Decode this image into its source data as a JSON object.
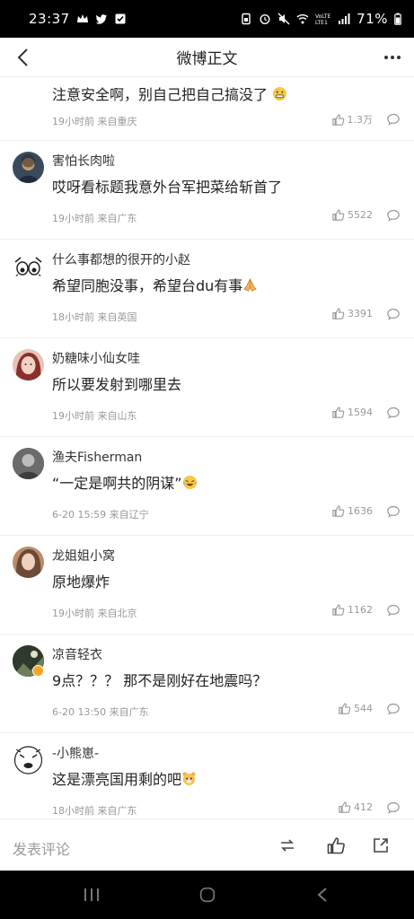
{
  "status_bar": {
    "time": "23:37",
    "battery": "71%"
  },
  "nav": {
    "title": "微博正文"
  },
  "comments": [
    {
      "user": "",
      "text": "注意安全啊，别自己把自己搞没了",
      "meta": "19小时前 来自重庆",
      "likes": "1.3万"
    },
    {
      "user": "害怕长肉啦",
      "text": "哎呀看标题我意外台军把菜给斩首了",
      "meta": "19小时前 来自广东",
      "likes": "5522"
    },
    {
      "user": "什么事都想的很开的小赵",
      "text": "希望同胞没事，希望台du有事",
      "meta": "18小时前 来自英国",
      "likes": "3391"
    },
    {
      "user": "奶糖味小仙女哇",
      "text": "所以要发射到哪里去",
      "meta": "19小时前 来自山东",
      "likes": "1594"
    },
    {
      "user": "渔夫Fisherman",
      "text": "“一定是啊共的阴谋”",
      "meta": "6-20 15:59 来自辽宁",
      "likes": "1636"
    },
    {
      "user": "龙姐姐小窝",
      "text": "原地爆炸",
      "meta": "19小时前 来自北京",
      "likes": "1162"
    },
    {
      "user": "凉音轻衣",
      "text": "9点？？？ 那不是刚好在地震吗？",
      "meta": "6-20 13:50 来自广东",
      "likes": "544"
    },
    {
      "user": "-小熊崽-",
      "text": "这是漂亮国用剩的吧",
      "meta": "18小时前 来自广东",
      "likes": "412"
    }
  ],
  "bottom_bar": {
    "placeholder": "发表评论"
  }
}
